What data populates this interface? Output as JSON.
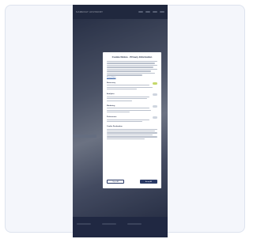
{
  "site": {
    "logo": "SAMEDAY ADVISORY"
  },
  "cookie_modal": {
    "title": "Cookie Notice - Privacy Information",
    "intro_link": "Privacy Notice",
    "sections": [
      {
        "title": "Necessary",
        "toggle_on": true
      },
      {
        "title": "Analytics",
        "toggle_on": false
      },
      {
        "title": "Marketing",
        "toggle_on": false
      },
      {
        "title": "Preferences",
        "toggle_on": false
      },
      {
        "title": "Cookie Declaration"
      }
    ],
    "reject_label": "Reject All",
    "accept_label": "Accept All"
  }
}
